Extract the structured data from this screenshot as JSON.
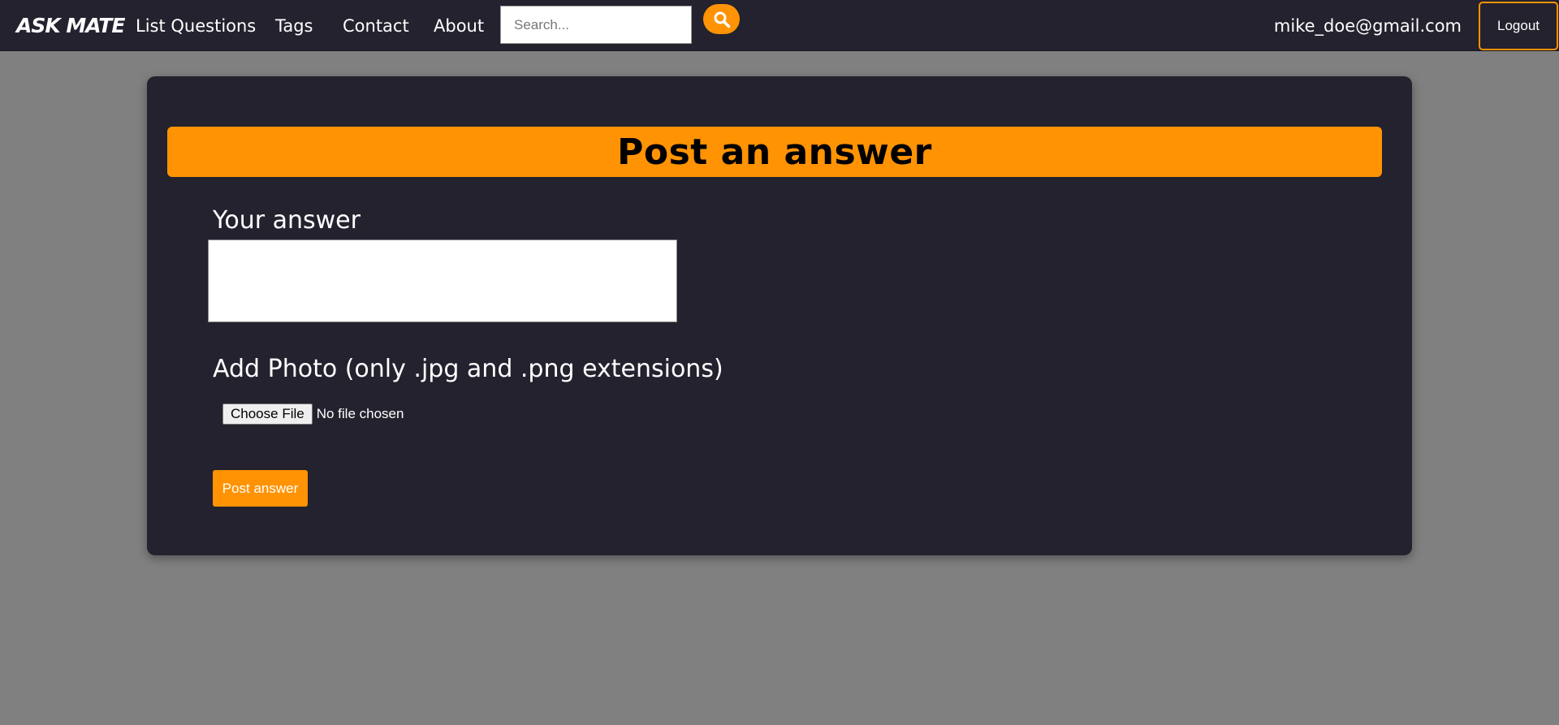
{
  "nav": {
    "logo": "ASK MATE",
    "links": [
      "List Questions",
      "Tags",
      "Contact",
      "About"
    ],
    "search_placeholder": "Search...",
    "search_icon": "magnifier-icon",
    "user_email": "mike_doe@gmail.com",
    "logout_label": "Logout"
  },
  "form": {
    "title": "Post an answer",
    "answer_label": "Your answer",
    "answer_value": "",
    "photo_label": "Add Photo (only .jpg and .png extensions)",
    "choose_file_label": "Choose File",
    "file_status": "No file chosen",
    "submit_label": "Post answer"
  },
  "colors": {
    "accent": "#ff9304",
    "nav_bg": "#23222e",
    "page_bg": "#808080"
  }
}
